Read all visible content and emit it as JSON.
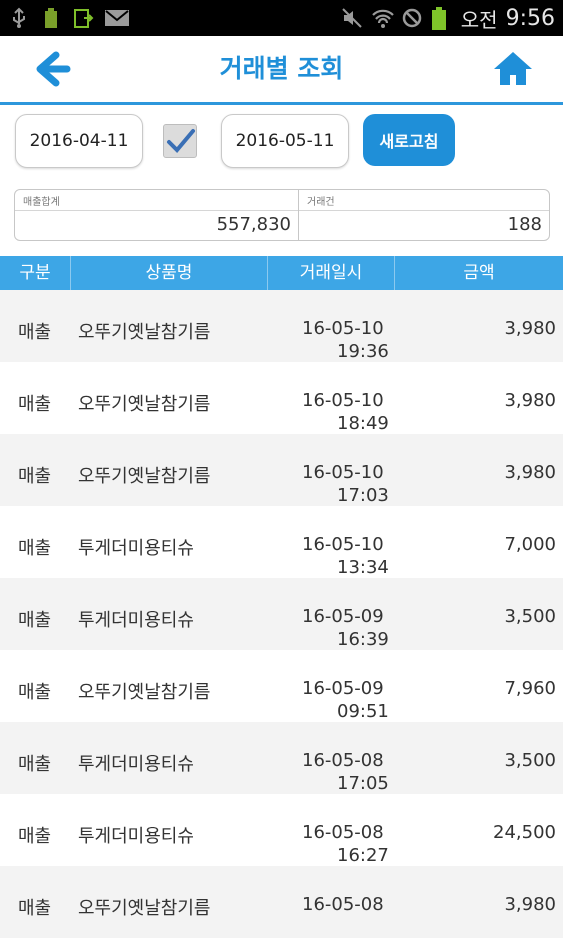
{
  "status_bar": {
    "ampm": "오전",
    "time": "9:56",
    "left_icons": [
      "usb-icon",
      "battery-100-icon",
      "download-icon",
      "mail-icon"
    ],
    "right_icons": [
      "mute-icon",
      "wifi-icon",
      "blocked-icon",
      "battery-icon"
    ]
  },
  "app_bar": {
    "title": "거래별 조회",
    "accent_color": "#1f8fd8"
  },
  "filter": {
    "start_date": "2016-04-11",
    "end_date": "2016-05-11",
    "checkbox_checked": true,
    "refresh_label": "새로고침"
  },
  "summary": {
    "sales_total_label": "매출합계",
    "sales_total": "557,830",
    "tx_count_label": "거래건",
    "tx_count": "188"
  },
  "table": {
    "headers": [
      "구분",
      "상품명",
      "거래일시",
      "금액"
    ],
    "rows": [
      {
        "type": "매출",
        "product": "오뚜기옛날참기름",
        "date": "16-05-10",
        "time": "19:36",
        "amount": "3,980"
      },
      {
        "type": "매출",
        "product": "오뚜기옛날참기름",
        "date": "16-05-10",
        "time": "18:49",
        "amount": "3,980"
      },
      {
        "type": "매출",
        "product": "오뚜기옛날참기름",
        "date": "16-05-10",
        "time": "17:03",
        "amount": "3,980"
      },
      {
        "type": "매출",
        "product": "투게더미용티슈",
        "date": "16-05-10",
        "time": "13:34",
        "amount": "7,000"
      },
      {
        "type": "매출",
        "product": "투게더미용티슈",
        "date": "16-05-09",
        "time": "16:39",
        "amount": "3,500"
      },
      {
        "type": "매출",
        "product": "오뚜기옛날참기름",
        "date": "16-05-09",
        "time": "09:51",
        "amount": "7,960"
      },
      {
        "type": "매출",
        "product": "투게더미용티슈",
        "date": "16-05-08",
        "time": "17:05",
        "amount": "3,500"
      },
      {
        "type": "매출",
        "product": "투게더미용티슈",
        "date": "16-05-08",
        "time": "16:27",
        "amount": "24,500"
      },
      {
        "type": "매출",
        "product": "오뚜기옛날참기름",
        "date": "16-05-08",
        "time": "",
        "amount": "3,980"
      }
    ]
  }
}
